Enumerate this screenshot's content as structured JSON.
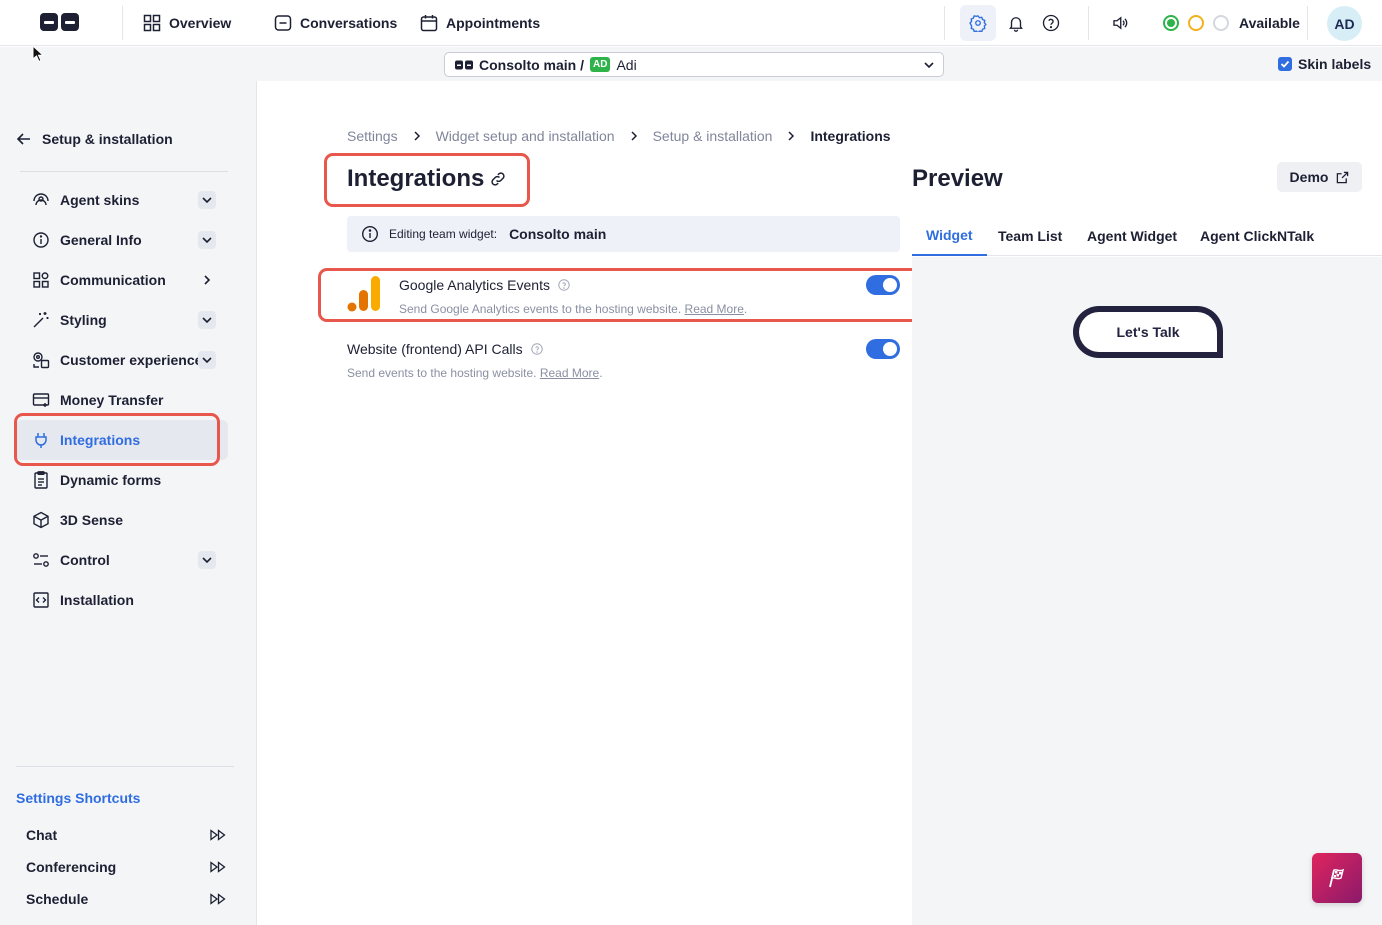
{
  "topnav": {
    "overview": "Overview",
    "conversations": "Conversations",
    "appointments": "Appointments",
    "status": "Available",
    "avatar": "AD"
  },
  "context": {
    "main": "Consolto main /",
    "badge": "AD",
    "agent": "Adi",
    "skin_labels": "Skin labels"
  },
  "sidebar": {
    "back": "Setup & installation",
    "items": [
      {
        "label": "Agent skins",
        "icon": "agent-skins-icon"
      },
      {
        "label": "General Info",
        "icon": "info-icon"
      },
      {
        "label": "Communication",
        "icon": "communication-icon"
      },
      {
        "label": "Styling",
        "icon": "magic-wand-icon"
      },
      {
        "label": "Customer experience",
        "icon": "customer-experience-icon"
      },
      {
        "label": "Money Transfer",
        "icon": "credit-card-icon"
      },
      {
        "label": "Integrations",
        "icon": "plug-icon"
      },
      {
        "label": "Dynamic forms",
        "icon": "form-icon"
      },
      {
        "label": "3D Sense",
        "icon": "cube-icon"
      },
      {
        "label": "Control",
        "icon": "control-icon"
      },
      {
        "label": "Installation",
        "icon": "code-icon"
      }
    ],
    "shortcuts_title": "Settings Shortcuts",
    "shortcuts": [
      "Chat",
      "Conferencing",
      "Schedule"
    ]
  },
  "breadcrumb": [
    "Settings",
    "Widget setup and installation",
    "Setup & installation",
    "Integrations"
  ],
  "page_title": "Integrations",
  "edit_banner": {
    "label": "Editing team widget:",
    "team": "Consolto main"
  },
  "integrations": [
    {
      "title": "Google Analytics Events",
      "desc": "Send Google Analytics events to the hosting website.",
      "link": "Read More",
      "enabled": true
    },
    {
      "title": "Website (frontend) API Calls",
      "desc": "Send events to the hosting website.",
      "link": "Read More",
      "enabled": true
    }
  ],
  "preview": {
    "title": "Preview",
    "demo": "Demo",
    "tabs": [
      "Widget",
      "Team List",
      "Agent Widget",
      "Agent ClickNTalk"
    ],
    "active_tab": "Widget",
    "button": "Let's Talk"
  },
  "colors": {
    "accent": "#2f6de1",
    "highlight": "#e8574c",
    "widget_dark": "#23223f"
  }
}
